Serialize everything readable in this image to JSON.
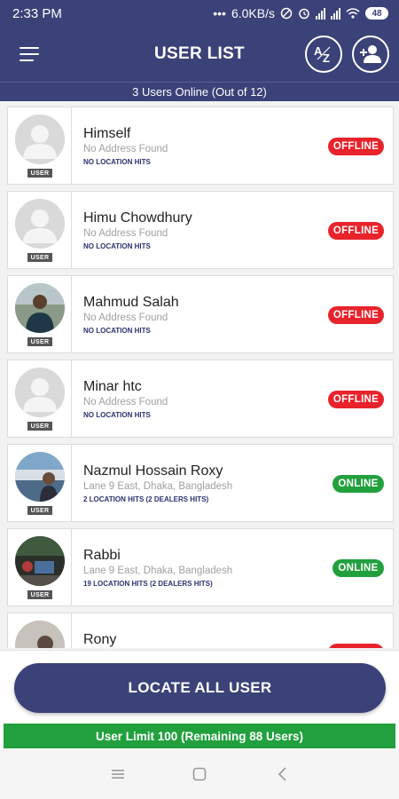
{
  "status_bar": {
    "time": "2:33 PM",
    "dots": "•••",
    "net_speed": "6.0KB/s",
    "battery": "48"
  },
  "app_bar": {
    "title": "USER LIST",
    "sort_icon": "az-sort-icon",
    "add_icon": "add-user-icon",
    "menu_icon": "hamburger-menu-icon"
  },
  "online_summary": "3 Users Online (Out of 12)",
  "users": [
    {
      "name": "Himself",
      "address": "No Address Found",
      "hits": "NO LOCATION HITS",
      "status": "OFFLINE",
      "tag": "USER"
    },
    {
      "name": "Himu Chowdhury",
      "address": "No Address Found",
      "hits": "NO LOCATION HITS",
      "status": "OFFLINE",
      "tag": "USER"
    },
    {
      "name": "Mahmud Salah",
      "address": "No Address Found",
      "hits": "NO LOCATION HITS",
      "status": "OFFLINE",
      "tag": "USER"
    },
    {
      "name": "Minar htc",
      "address": "No Address Found",
      "hits": "NO LOCATION HITS",
      "status": "OFFLINE",
      "tag": "USER"
    },
    {
      "name": "Nazmul Hossain Roxy",
      "address": "Lane 9 East, Dhaka, Bangladesh",
      "hits": "2 LOCATION HITS (2 DEALERS HITS)",
      "status": "ONLINE",
      "tag": "USER"
    },
    {
      "name": "Rabbi",
      "address": "Lane 9 East, Dhaka, Bangladesh",
      "hits": "19 LOCATION HITS (2 DEALERS HITS)",
      "status": "ONLINE",
      "tag": "USER"
    },
    {
      "name": "Rony",
      "address": "",
      "hits": "",
      "status": "",
      "tag": ""
    }
  ],
  "locate_button": "LOCATE ALL USER",
  "limit_text": "User Limit 100 (Remaining 88 Users)",
  "colors": {
    "primary": "#3b4278",
    "offline": "#e8232b",
    "online": "#21a03d"
  }
}
